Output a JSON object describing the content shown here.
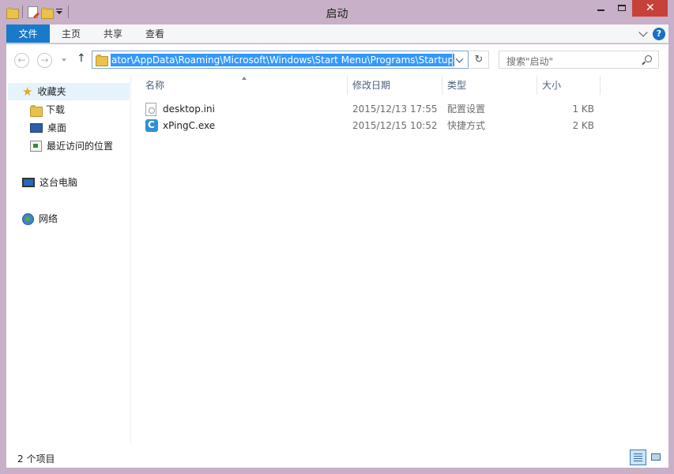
{
  "window": {
    "title": "启动",
    "close_glyph": "✕"
  },
  "ribbon": {
    "tabs": [
      {
        "label": "文件"
      },
      {
        "label": "主页"
      },
      {
        "label": "共享"
      },
      {
        "label": "查看"
      }
    ],
    "help_glyph": "?"
  },
  "nav": {
    "back_glyph": "←",
    "forward_glyph": "→",
    "up_glyph": "↑",
    "address": "ator\\AppData\\Roaming\\Microsoft\\Windows\\Start Menu\\Programs\\Startup",
    "refresh_glyph": "↻",
    "search_placeholder": "搜索\"启动\""
  },
  "sidebar": {
    "favorites": "收藏夹",
    "items": [
      {
        "label": "下载"
      },
      {
        "label": "桌面"
      },
      {
        "label": "最近访问的位置"
      }
    ],
    "this_pc": "这台电脑",
    "network": "网络"
  },
  "columns": [
    {
      "label": "名称"
    },
    {
      "label": "修改日期"
    },
    {
      "label": "类型"
    },
    {
      "label": "大小"
    }
  ],
  "files": [
    {
      "name": "desktop.ini",
      "date": "2015/12/13 17:55",
      "type": "配置设置",
      "size": "1 KB",
      "icon": "settings-file-icon"
    },
    {
      "name": "xPingC.exe",
      "date": "2015/12/15 10:52",
      "type": "快捷方式",
      "size": "2 KB",
      "icon": "exe-icon"
    }
  ],
  "status": {
    "count": "2 个项目"
  },
  "colors": {
    "file_tab": "#1979ca",
    "selection": "#3399ff",
    "close_button": "#c7413a",
    "frame": "#c7b0c8"
  }
}
